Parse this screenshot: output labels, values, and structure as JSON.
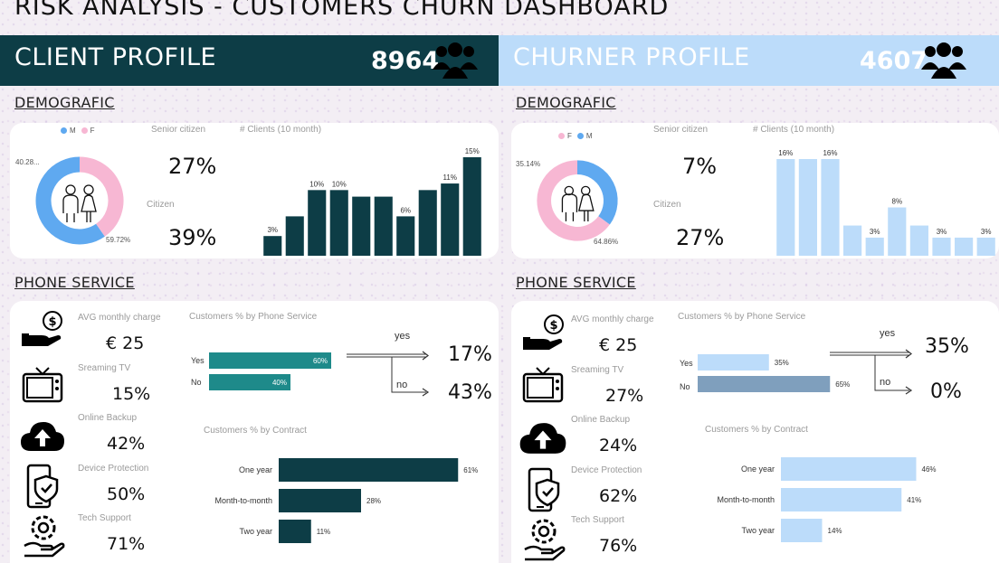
{
  "header": {
    "title": "RISK ANALYSIS - CUSTOMERS CHURN DASHBOARD"
  },
  "colors": {
    "dark": "#0d3d46",
    "teal": "#1e8a8a",
    "light_blue": "#bcdcfa",
    "pink": "#f7b7d3",
    "blue": "#5fa9f0",
    "slate": "#7f9fbd"
  },
  "client": {
    "banner_title": "CLIENT PROFILE",
    "count": "8964",
    "demo_heading": "DEMOGRAFIC",
    "legend_first": "M",
    "legend_second": "F",
    "donut_label_small": "40.28...",
    "donut_label_large": "59.72%",
    "senior_label": "Senior citizen",
    "senior_value": "27%",
    "citizen_label": "Citizen",
    "citizen_value": "39%",
    "hist_title": "# Clients (10 month)",
    "phone_heading": "PHONE SERVICE",
    "avg_label": "AVG monthly charge",
    "avg_value": "€ 25",
    "tv_label": "Sreaming TV",
    "tv_value": "15%",
    "backup_label": "Online Backup",
    "backup_value": "42%",
    "protect_label": "Device Protection",
    "protect_value": "50%",
    "support_label": "Tech Support",
    "support_value": "71%",
    "phone_chart_title": "Customers % by Phone Service",
    "yes_label": "Yes",
    "no_label": "No",
    "arrow_yes": "yes",
    "arrow_no": "no",
    "yes_result": "17%",
    "no_result": "43%",
    "contract_title": "Customers % by Contract"
  },
  "churner": {
    "banner_title": "CHURNER PROFILE",
    "count": "4607",
    "demo_heading": "DEMOGRAFIC",
    "legend_first": "F",
    "legend_second": "M",
    "donut_label_small": "35.14%",
    "donut_label_large": "64.86%",
    "senior_label": "Senior citizen",
    "senior_value": "7%",
    "citizen_label": "Citizen",
    "citizen_value": "27%",
    "hist_title": "# Clients (10 month)",
    "phone_heading": "PHONE SERVICE",
    "avg_label": "AVG monthly charge",
    "avg_value": "€ 25",
    "tv_label": "Sreaming TV",
    "tv_value": "27%",
    "backup_label": "Online Backup",
    "backup_value": "24%",
    "protect_label": "Device Protection",
    "protect_value": "62%",
    "support_label": "Tech Support",
    "support_value": "76%",
    "phone_chart_title": "Customers % by Phone Service",
    "yes_label": "Yes",
    "no_label": "No",
    "arrow_yes": "yes",
    "arrow_no": "no",
    "yes_result": "35%",
    "no_result": "0%",
    "contract_title": "Customers % by Contract"
  },
  "chart_data": [
    {
      "id": "client-gender",
      "type": "pie",
      "title": "",
      "categories": [
        "M",
        "F"
      ],
      "values": [
        59.72,
        40.28
      ]
    },
    {
      "id": "client-hist",
      "type": "bar",
      "title": "# Clients (10 month)",
      "values": [
        3,
        6,
        10,
        10,
        9,
        9,
        6,
        10,
        11,
        15
      ],
      "labels": [
        "3%",
        "",
        "10%",
        "10%",
        "",
        "",
        "6%",
        "",
        "11%",
        "15%"
      ],
      "ylim": [
        0,
        15
      ]
    },
    {
      "id": "client-phone",
      "type": "bar",
      "title": "Customers % by Phone Service",
      "categories": [
        "Yes",
        "No"
      ],
      "values": [
        60,
        40
      ],
      "labels": [
        "60%",
        "40%"
      ]
    },
    {
      "id": "client-contract",
      "type": "bar",
      "title": "Customers % by Contract",
      "categories": [
        "One year",
        "Month-to-month",
        "Two year"
      ],
      "values": [
        61,
        28,
        11
      ],
      "labels": [
        "61%",
        "28%",
        "11%"
      ]
    },
    {
      "id": "churner-gender",
      "type": "pie",
      "title": "",
      "categories": [
        "F",
        "M"
      ],
      "values": [
        64.86,
        35.14
      ]
    },
    {
      "id": "churner-hist",
      "type": "bar",
      "title": "# Clients (10 month)",
      "values": [
        16,
        16,
        16,
        5,
        3,
        8,
        5,
        3,
        3,
        3
      ],
      "labels": [
        "16%",
        "",
        "16%",
        "",
        "3%",
        "8%",
        "",
        "3%",
        "",
        "3%"
      ],
      "ylim": [
        0,
        16
      ]
    },
    {
      "id": "churner-phone",
      "type": "bar",
      "title": "Customers % by Phone Service",
      "categories": [
        "Yes",
        "No"
      ],
      "values": [
        35,
        65
      ],
      "labels": [
        "35%",
        "65%"
      ]
    },
    {
      "id": "churner-contract",
      "type": "bar",
      "title": "Customers % by Contract",
      "categories": [
        "One year",
        "Month-to-month",
        "Two year"
      ],
      "values": [
        46,
        41,
        14
      ],
      "labels": [
        "46%",
        "41%",
        "14%"
      ]
    }
  ]
}
